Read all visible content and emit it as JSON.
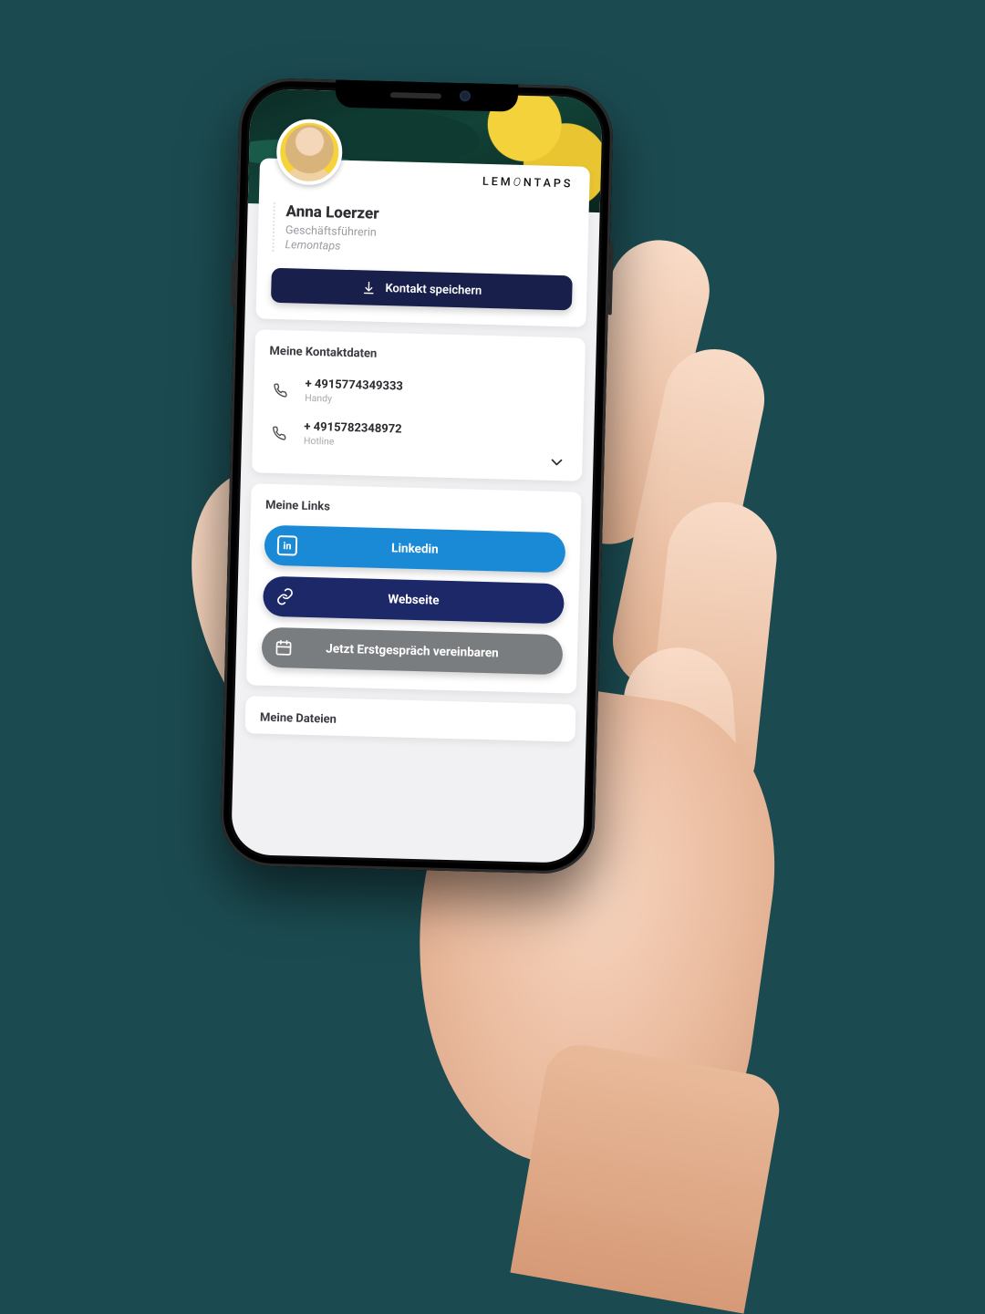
{
  "brand": "LEMONTAPS",
  "profile": {
    "name": "Anna Loerzer",
    "role": "Geschäftsführerin",
    "company": "Lemontaps",
    "save_contact_label": "Kontakt speichern"
  },
  "contacts": {
    "title": "Meine Kontaktdaten",
    "items": [
      {
        "value": "+ 4915774349333",
        "label": "Handy"
      },
      {
        "value": "+ 4915782348972",
        "label": "Hotline"
      }
    ]
  },
  "links": {
    "title": "Meine Links",
    "items": [
      {
        "label": "Linkedin",
        "icon": "linkedin-icon",
        "color": "blue"
      },
      {
        "label": "Webseite",
        "icon": "link-icon",
        "color": "navy"
      },
      {
        "label": "Jetzt Erstgespräch vereinbaren",
        "icon": "calendar-icon",
        "color": "gray"
      }
    ]
  },
  "files": {
    "title": "Meine Dateien"
  },
  "colors": {
    "accent_blue": "#1a8ad6",
    "accent_navy": "#1d2869",
    "accent_gray": "#7a7d80",
    "save_button": "#181f4a"
  }
}
